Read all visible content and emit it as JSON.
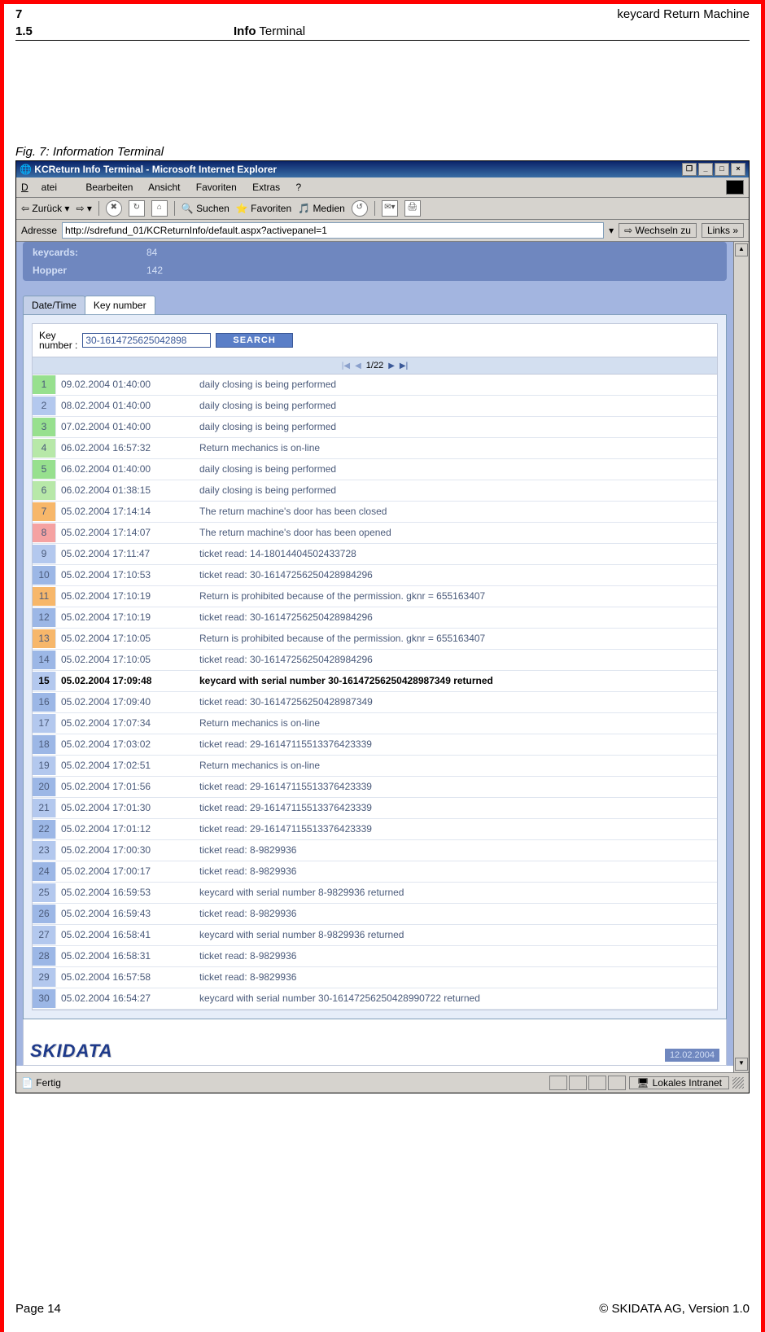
{
  "doc": {
    "chapter_num": "7",
    "chapter_title": "keycard Return Machine",
    "section_num": "1.5",
    "section_title_bold": "Info",
    "section_title_rest": " Terminal",
    "fig_caption": "Fig. 7: Information Terminal",
    "page_label": "Page 14",
    "copyright": "© SKIDATA AG, Version 1.0"
  },
  "browser": {
    "title": "KCReturn Info Terminal - Microsoft Internet Explorer",
    "menus": {
      "m1": "Datei",
      "m2": "Bearbeiten",
      "m3": "Ansicht",
      "m4": "Favoriten",
      "m5": "Extras",
      "m6": "?"
    },
    "back_label": "Zurück",
    "search_label": "Suchen",
    "fav_label": "Favoriten",
    "media_label": "Medien",
    "addr_label": "Adresse",
    "url": "http://sdrefund_01/KCReturnInfo/default.aspx?activepanel=1",
    "go_label": "Wechseln zu",
    "links_label": "Links",
    "status_left": "Fertig",
    "status_zone": "Lokales Intranet"
  },
  "app": {
    "stats": {
      "keycards_lbl": "keycards:",
      "keycards_val": "84",
      "hopper_lbl": "Hopper",
      "hopper_val": "142"
    },
    "tabs": {
      "t1": "Date/Time",
      "t2": "Key number"
    },
    "search": {
      "label": "Key\nnumber :",
      "value": "30-1614725625042898",
      "button": "SEARCH"
    },
    "pager": "1/22",
    "footer_date": "12.02.2004",
    "brand": "SKIDATA",
    "rows": [
      {
        "n": "1",
        "c": "c-green",
        "dt": "09.02.2004 01:40:00",
        "msg": "daily closing is being performed"
      },
      {
        "n": "2",
        "c": "c-blue",
        "dt": "08.02.2004 01:40:00",
        "msg": "daily closing is being performed"
      },
      {
        "n": "3",
        "c": "c-green",
        "dt": "07.02.2004 01:40:00",
        "msg": "daily closing is being performed"
      },
      {
        "n": "4",
        "c": "c-green2",
        "dt": "06.02.2004 16:57:32",
        "msg": "Return mechanics is on-line"
      },
      {
        "n": "5",
        "c": "c-green",
        "dt": "06.02.2004 01:40:00",
        "msg": "daily closing is being performed"
      },
      {
        "n": "6",
        "c": "c-green2",
        "dt": "06.02.2004 01:38:15",
        "msg": "daily closing is being performed"
      },
      {
        "n": "7",
        "c": "c-orange",
        "dt": "05.02.2004 17:14:14",
        "msg": "The return machine's door has been closed"
      },
      {
        "n": "8",
        "c": "c-pink",
        "dt": "05.02.2004 17:14:07",
        "msg": "The return machine's door has been opened"
      },
      {
        "n": "9",
        "c": "c-blue",
        "dt": "05.02.2004 17:11:47",
        "msg": "ticket read: 14-18014404502433728"
      },
      {
        "n": "10",
        "c": "c-blue2",
        "dt": "05.02.2004 17:10:53",
        "msg": "ticket read: 30-16147256250428984296"
      },
      {
        "n": "11",
        "c": "c-orange",
        "dt": "05.02.2004 17:10:19",
        "msg": "Return is prohibited because of the permission. gknr = 655163407"
      },
      {
        "n": "12",
        "c": "c-blue2",
        "dt": "05.02.2004 17:10:19",
        "msg": "ticket read: 30-16147256250428984296"
      },
      {
        "n": "13",
        "c": "c-orange",
        "dt": "05.02.2004 17:10:05",
        "msg": "Return is prohibited because of the permission. gknr = 655163407"
      },
      {
        "n": "14",
        "c": "c-blue2",
        "dt": "05.02.2004 17:10:05",
        "msg": "ticket read: 30-16147256250428984296"
      },
      {
        "n": "15",
        "c": "c-blue",
        "dt": "05.02.2004 17:09:48",
        "msg": "keycard with serial number 30-16147256250428987349 returned",
        "bold": true
      },
      {
        "n": "16",
        "c": "c-blue2",
        "dt": "05.02.2004 17:09:40",
        "msg": "ticket read: 30-16147256250428987349"
      },
      {
        "n": "17",
        "c": "c-blue",
        "dt": "05.02.2004 17:07:34",
        "msg": "Return mechanics is on-line"
      },
      {
        "n": "18",
        "c": "c-blue2",
        "dt": "05.02.2004 17:03:02",
        "msg": "ticket read: 29-16147115513376423339"
      },
      {
        "n": "19",
        "c": "c-blue",
        "dt": "05.02.2004 17:02:51",
        "msg": "Return mechanics is on-line"
      },
      {
        "n": "20",
        "c": "c-blue2",
        "dt": "05.02.2004 17:01:56",
        "msg": "ticket read: 29-16147115513376423339"
      },
      {
        "n": "21",
        "c": "c-blue",
        "dt": "05.02.2004 17:01:30",
        "msg": "ticket read: 29-16147115513376423339"
      },
      {
        "n": "22",
        "c": "c-blue2",
        "dt": "05.02.2004 17:01:12",
        "msg": "ticket read: 29-16147115513376423339"
      },
      {
        "n": "23",
        "c": "c-blue",
        "dt": "05.02.2004 17:00:30",
        "msg": "ticket read: 8-9829936"
      },
      {
        "n": "24",
        "c": "c-blue2",
        "dt": "05.02.2004 17:00:17",
        "msg": "ticket read: 8-9829936"
      },
      {
        "n": "25",
        "c": "c-blue",
        "dt": "05.02.2004 16:59:53",
        "msg": "keycard with serial number 8-9829936 returned"
      },
      {
        "n": "26",
        "c": "c-blue2",
        "dt": "05.02.2004 16:59:43",
        "msg": "ticket read: 8-9829936"
      },
      {
        "n": "27",
        "c": "c-blue",
        "dt": "05.02.2004 16:58:41",
        "msg": "keycard with serial number 8-9829936 returned"
      },
      {
        "n": "28",
        "c": "c-blue2",
        "dt": "05.02.2004 16:58:31",
        "msg": "ticket read: 8-9829936"
      },
      {
        "n": "29",
        "c": "c-blue",
        "dt": "05.02.2004 16:57:58",
        "msg": "ticket read: 8-9829936"
      },
      {
        "n": "30",
        "c": "c-blue2",
        "dt": "05.02.2004 16:54:27",
        "msg": "keycard with serial number 30-16147256250428990722 returned"
      }
    ]
  }
}
